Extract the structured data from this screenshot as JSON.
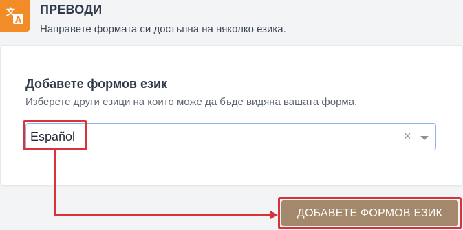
{
  "header": {
    "icon": "translate-icon",
    "title": "ПРЕВОДИ",
    "subtitle": "Направете формата си достъпна на няколко езика."
  },
  "card": {
    "title": "Добавете формов език",
    "subtitle": "Изберете други езици на които може да бъде видяна вашата форма.",
    "select": {
      "value": "Español",
      "clear_symbol": "×",
      "dropdown_icon": "chevron-down-icon"
    }
  },
  "actions": {
    "add_language_label": "ДОБАВЕТЕ ФОРМОВ ЕЗИК"
  },
  "colors": {
    "accent_orange": "#f28c28",
    "button_brown": "#a4886c",
    "annotation_red": "#d9323a",
    "focus_border": "#8fb3e6"
  }
}
